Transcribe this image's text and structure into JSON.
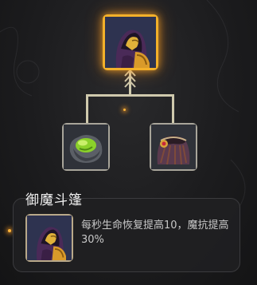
{
  "talent_tree": {
    "top_node": {
      "icon": "hooded-hero-icon",
      "selected": true
    },
    "left_node": {
      "icon": "green-orb-stone-icon",
      "selected": false
    },
    "right_node": {
      "icon": "cloak-amulet-icon",
      "selected": false
    }
  },
  "detail": {
    "title": "御魔斗篷",
    "description": "每秒生命恢复提高10，魔抗提高30%",
    "icon": "hooded-hero-icon"
  },
  "colors": {
    "selected_border": "#f3b02a",
    "node_border": "#a8a59a",
    "connector": "#cfc9ad",
    "panel_bg": "#202022"
  }
}
